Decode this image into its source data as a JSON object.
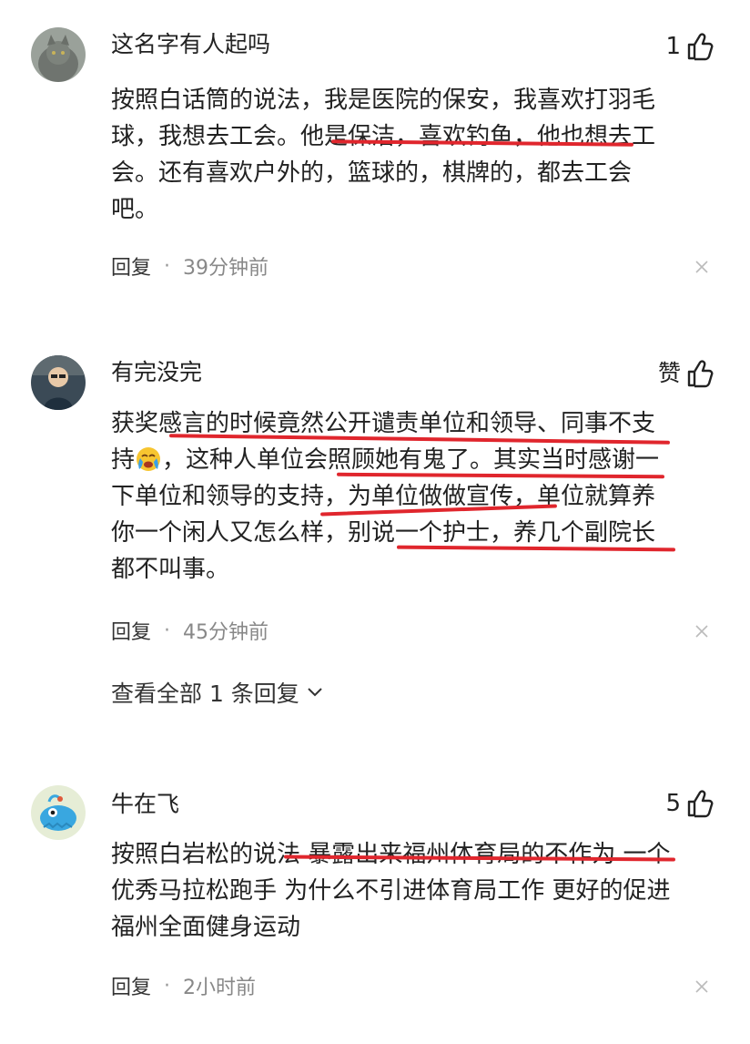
{
  "comments": [
    {
      "username": "这名字有人起吗",
      "likes": "1",
      "lines": [
        "按照白话筒的说法，我是医院的保安，我喜欢打羽毛",
        "球，我想去工会。他是保洁，喜欢钓鱼，他也想去工",
        "会。还有喜欢户外的，篮球的，棋牌的，都去工会",
        "吧。"
      ],
      "reply_label": "回复",
      "dot": "·",
      "time": "39分钟前"
    },
    {
      "username": "有完没完",
      "likes": "赞",
      "lines": [
        "获奖感言的时候竟然公开谴责单位和领导、同事不支",
        "持",
        "，这种人单位会照顾她有鬼了。其实当时感谢一",
        "下单位和领导的支持，为单位做做宣传，单位就算养",
        "你一个闲人又怎么样，别说一个护士，养几个副院长",
        "都不叫事。"
      ],
      "reply_label": "回复",
      "dot": "·",
      "time": "45分钟前",
      "view_all": "查看全部 1 条回复"
    },
    {
      "username": "牛在飞",
      "likes": "5",
      "lines": [
        "按照白岩松的说法 暴露出来福州体育局的不作为 一个",
        "优秀马拉松跑手 为什么不引进体育局工作 更好的促进",
        "福州全面健身运动"
      ],
      "reply_label": "回复",
      "dot": "·",
      "time": "2小时前"
    }
  ],
  "colors": {
    "underline": "#e0262d",
    "meta": "#888888",
    "text": "#222222"
  }
}
